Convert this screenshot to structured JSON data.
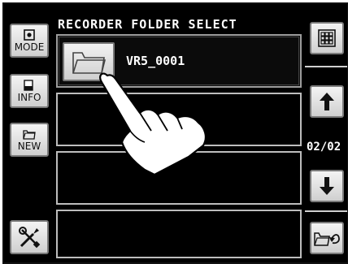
{
  "header": {
    "title": "RECORDER FOLDER SELECT"
  },
  "left_toolbar": {
    "items": [
      {
        "label": "MODE",
        "icon": "mode-icon"
      },
      {
        "label": "INFO",
        "icon": "info-icon"
      },
      {
        "label": "NEW",
        "icon": "new-folder-icon"
      },
      {
        "label": "",
        "icon": "settings-tools-icon"
      }
    ]
  },
  "folders": [
    {
      "name": "VR5_0001",
      "selected": true
    },
    {
      "name": ""
    },
    {
      "name": ""
    },
    {
      "name": ""
    }
  ],
  "right_toolbar": {
    "grid_icon": "grid-view-icon",
    "up_icon": "arrow-up-icon",
    "down_icon": "arrow-down-icon",
    "back_icon": "back-folder-icon",
    "page_indicator": "02/02"
  },
  "colors": {
    "background": "#000000",
    "button": "#e0e0e0",
    "text": "#ffffff",
    "border": "#bdbdbd"
  }
}
